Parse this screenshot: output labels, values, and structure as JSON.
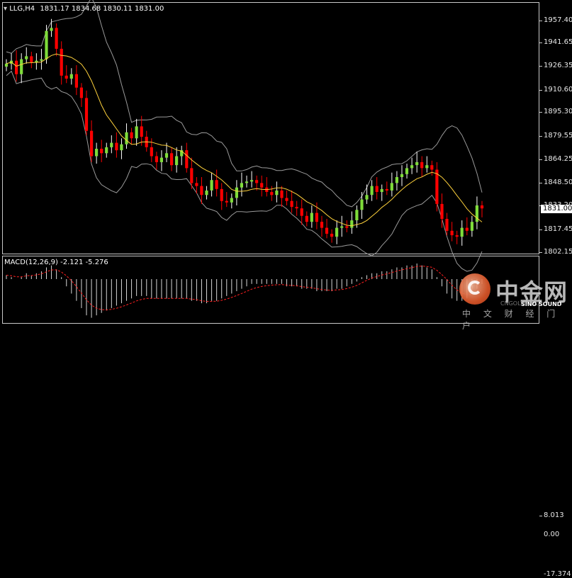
{
  "header": {
    "symbol_tf": "LLG,H4",
    "ohlc": "1831.17 1834.68 1830.11 1831.00"
  },
  "price_scale": {
    "ticks": [
      "1957.40",
      "1941.65",
      "1926.35",
      "1910.60",
      "1895.30",
      "1879.55",
      "1864.25",
      "1848.50",
      "1833.20",
      "1817.45",
      "1802.15"
    ]
  },
  "current_price": "1831.00",
  "macd": {
    "label": "MACD(12,26,9) -2.121 -5.276",
    "scale_top": "8.013",
    "scale_zero": "0.00",
    "scale_bottom": "-17.374"
  },
  "watermark": {
    "title": "中金网",
    "url": "CNGOLD.ORG",
    "sub": "中 文 财 经 门 户",
    "brand": "SINO SOUND"
  },
  "colors": {
    "bull": "#ffffff",
    "bear": "#ff0000",
    "bull_body": "#7fdc3a",
    "ma": "#ffd23c",
    "bands": "#9a9a9a",
    "macd_hist": "#d8d8d8",
    "macd_signal": "#ff2020"
  },
  "chart_data": {
    "type": "candlestick",
    "ylim": [
      1802.15,
      1957.4
    ],
    "closes": [
      1928,
      1930,
      1921,
      1931,
      1933,
      1929,
      1930,
      1931,
      1950,
      1952,
      1938,
      1920,
      1918,
      1921,
      1912,
      1905,
      1883,
      1866,
      1871,
      1868,
      1872,
      1875,
      1870,
      1874,
      1882,
      1878,
      1886,
      1879,
      1872,
      1866,
      1862,
      1865,
      1868,
      1860,
      1866,
      1870,
      1858,
      1848,
      1846,
      1840,
      1843,
      1850,
      1844,
      1836,
      1835,
      1838,
      1845,
      1848,
      1849,
      1850,
      1848,
      1845,
      1842,
      1840,
      1843,
      1838,
      1836,
      1832,
      1831,
      1826,
      1822,
      1828,
      1822,
      1818,
      1814,
      1812,
      1818,
      1819,
      1818,
      1823,
      1830,
      1837,
      1840,
      1846,
      1842,
      1844,
      1843,
      1848,
      1852,
      1854,
      1858,
      1860,
      1862,
      1858,
      1860,
      1857,
      1834,
      1824,
      1816,
      1813,
      1812,
      1818,
      1816,
      1822,
      1833,
      1831
    ],
    "macd_hist": [
      2,
      1,
      0,
      1,
      3,
      2,
      3,
      4,
      6,
      7,
      5,
      1,
      -3,
      -6,
      -9,
      -12,
      -15,
      -16,
      -15,
      -14,
      -13,
      -12,
      -11,
      -10,
      -9,
      -8,
      -7,
      -7,
      -7,
      -8,
      -8,
      -8,
      -8,
      -8,
      -8,
      -8,
      -8,
      -9,
      -9,
      -10,
      -10,
      -9,
      -9,
      -8,
      -7,
      -6,
      -5,
      -4,
      -3,
      -2,
      -2,
      -2,
      -2,
      -2,
      -2,
      -2,
      -3,
      -3,
      -3,
      -4,
      -4,
      -4,
      -5,
      -5,
      -5,
      -5,
      -4,
      -4,
      -3,
      -2,
      -1,
      1,
      2,
      3,
      3,
      4,
      4,
      5,
      6,
      6,
      7,
      7,
      8,
      7,
      6,
      5,
      1,
      -3,
      -6,
      -8,
      -9,
      -9,
      -8,
      -6,
      -4,
      -2
    ]
  }
}
